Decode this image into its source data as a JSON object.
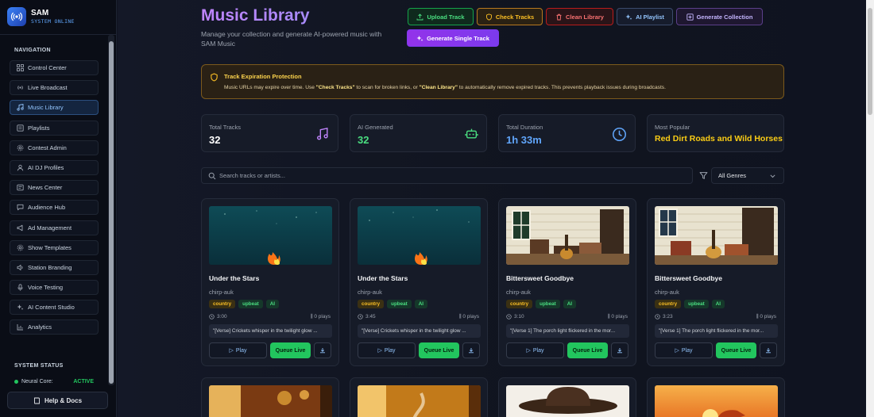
{
  "brand": {
    "name": "SAM",
    "status": "SYSTEM ONLINE"
  },
  "sidebar": {
    "nav_title": "NAVIGATION",
    "items": [
      {
        "label": "Control Center",
        "icon": "grid-icon"
      },
      {
        "label": "Live Broadcast",
        "icon": "broadcast-icon"
      },
      {
        "label": "Music Library",
        "icon": "music-note-icon",
        "active": true
      },
      {
        "label": "Playlists",
        "icon": "list-icon"
      },
      {
        "label": "Contest Admin",
        "icon": "gear-icon"
      },
      {
        "label": "AI DJ Profiles",
        "icon": "user-icon"
      },
      {
        "label": "News Center",
        "icon": "newspaper-icon"
      },
      {
        "label": "Audience Hub",
        "icon": "chat-icon"
      },
      {
        "label": "Ad Management",
        "icon": "megaphone-icon"
      },
      {
        "label": "Show Templates",
        "icon": "gear-icon"
      },
      {
        "label": "Station Branding",
        "icon": "speaker-icon"
      },
      {
        "label": "Voice Testing",
        "icon": "mic-icon"
      },
      {
        "label": "AI Content Studio",
        "icon": "sparkle-icon"
      },
      {
        "label": "Analytics",
        "icon": "bar-chart-icon"
      }
    ],
    "system_title": "SYSTEM STATUS",
    "system_row": {
      "label": "Neural Core:",
      "value": "ACTIVE"
    },
    "help_label": "Help & Docs"
  },
  "header": {
    "title": "Music Library",
    "subtitle": "Manage your collection and generate AI-powered music with SAM Music",
    "buttons": {
      "upload": "Upload Track",
      "check": "Check Tracks",
      "clean": "Clean Library",
      "ai_playlist": "AI Playlist",
      "collection": "Generate Collection",
      "single": "Generate Single Track"
    }
  },
  "banner": {
    "title": "Track Expiration Protection",
    "text_1": "Music URLs may expire over time. Use ",
    "text_check": "\"Check Tracks\"",
    "text_2": " to scan for broken links, or ",
    "text_clean": "\"Clean Library\"",
    "text_3": " to automatically remove expired tracks. This prevents playback issues during broadcasts."
  },
  "stats": [
    {
      "label": "Total Tracks",
      "value": "32",
      "icon": "music-notes-icon",
      "color": "#ffffff",
      "icon_color": "#c084fc"
    },
    {
      "label": "AI Generated",
      "value": "32",
      "icon": "robot-icon",
      "color": "#4ade80",
      "icon_color": "#4ade80"
    },
    {
      "label": "Total Duration",
      "value": "1h 33m",
      "icon": "clock-icon",
      "color": "#60a5fa",
      "icon_color": "#60a5fa"
    },
    {
      "label": "Most Popular",
      "value": "Red Dirt Roads and Wild Horses",
      "icon": "",
      "color": "#facc15",
      "icon_color": ""
    }
  ],
  "search": {
    "placeholder": "Search tracks or artists...",
    "genre": "All Genres"
  },
  "tracks": [
    {
      "title": "Under the Stars",
      "artist": "chirp-auk",
      "tags": [
        "country",
        "upbeat",
        "AI"
      ],
      "duration": "3:00",
      "plays": "0 plays",
      "lyrics": "\"[Verse] Crickets whisper in the twilight glow ...",
      "play": "Play",
      "queue": "Queue Live",
      "cover": "campfire"
    },
    {
      "title": "Under the Stars",
      "artist": "chirp-auk",
      "tags": [
        "country",
        "upbeat",
        "AI"
      ],
      "duration": "3:45",
      "plays": "0 plays",
      "lyrics": "\"[Verse] Crickets whisper in the twilight glow ...",
      "play": "Play",
      "queue": "Queue Live",
      "cover": "campfire"
    },
    {
      "title": "Bittersweet Goodbye",
      "artist": "chirp-auk",
      "tags": [
        "country",
        "upbeat",
        "AI"
      ],
      "duration": "3:10",
      "plays": "0 plays",
      "lyrics": "\"[Verse 1] The porch light flickered in the mor...",
      "play": "Play",
      "queue": "Queue Live",
      "cover": "porch"
    },
    {
      "title": "Bittersweet Goodbye",
      "artist": "chirp-auk",
      "tags": [
        "country",
        "upbeat",
        "AI"
      ],
      "duration": "3:23",
      "plays": "0 plays",
      "lyrics": "\"[Verse 1] The porch light flickered in the mor...",
      "play": "Play",
      "queue": "Queue Live",
      "cover": "porch"
    }
  ],
  "colors": {
    "accent": "#a78bfa",
    "success": "#22c55e",
    "warning": "#fbbf24",
    "danger": "#f87171",
    "info": "#60a5fa"
  }
}
